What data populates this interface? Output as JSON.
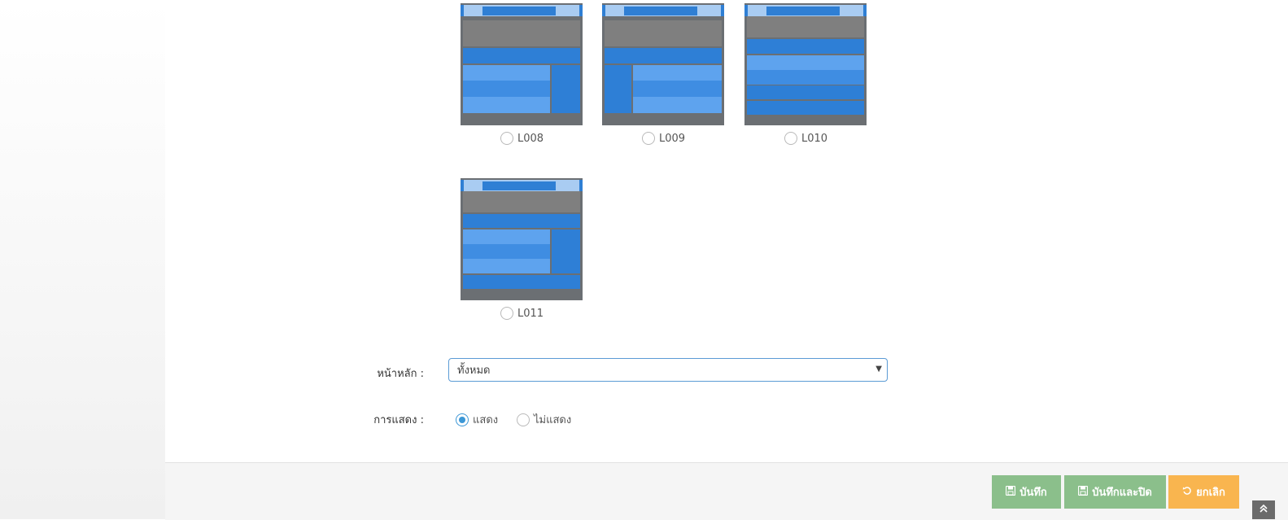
{
  "layouts": [
    {
      "id": "L008",
      "selected": false
    },
    {
      "id": "L009",
      "selected": false
    },
    {
      "id": "L010",
      "selected": false
    },
    {
      "id": "L011",
      "selected": false
    }
  ],
  "form": {
    "homepage_label": "หน้าหลัก :",
    "homepage_value": "ทั้งหมด",
    "display_label": "การแสดง :",
    "display_show": "แสดง",
    "display_hide": "ไม่แสดง",
    "display_selected": "แสดง"
  },
  "buttons": {
    "save": "บันทึก",
    "save_close": "บันทึกและปิด",
    "cancel": "ยกเลิก"
  },
  "icons": {
    "save": "floppy-disk-icon",
    "cancel": "undo-icon",
    "scroll_top": "double-chevron-up-icon"
  },
  "colors": {
    "primary_blue": "#2e7fd6",
    "save_green": "#8bbf8b",
    "cancel_orange": "#f9b54f",
    "radio_active": "#3c97d6"
  }
}
